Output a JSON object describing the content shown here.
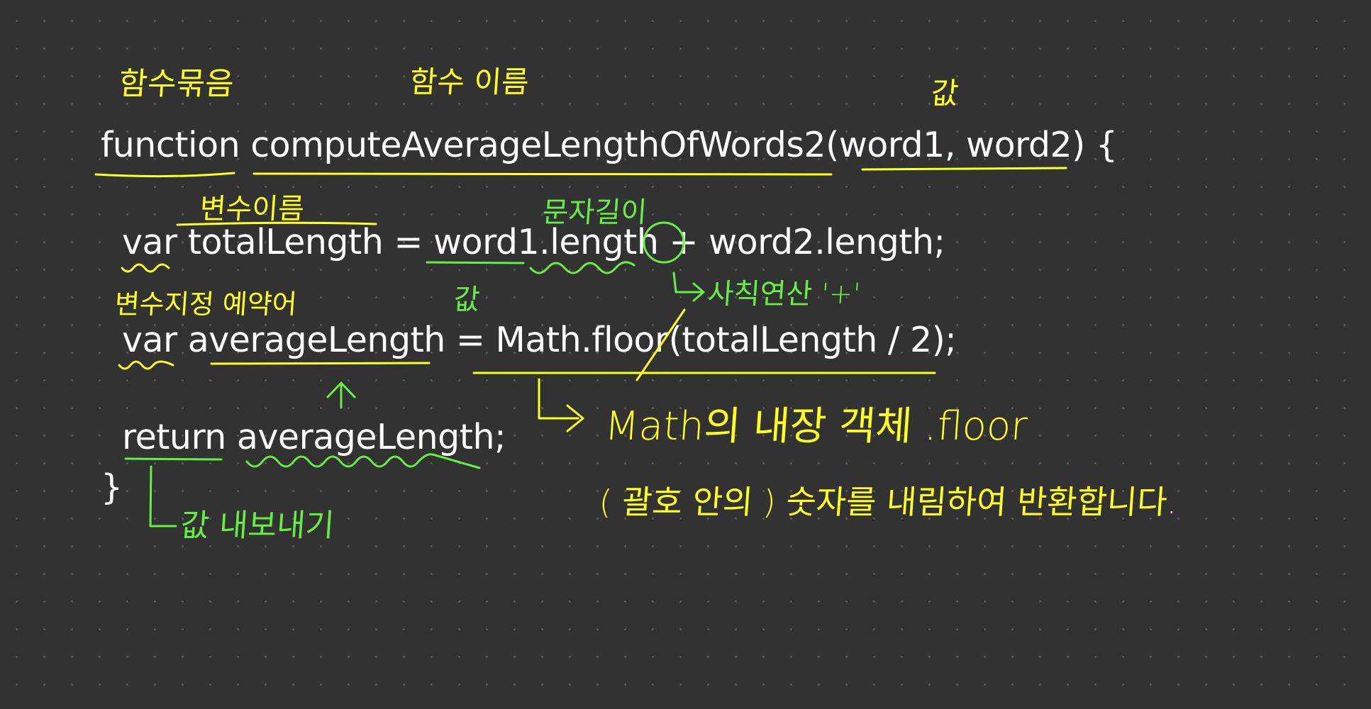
{
  "code_lines": {
    "line1": "function computeAverageLengthOfWords2(word1, word2) {",
    "line2": "var totalLength = word1.length + word2.length;",
    "line3": "var averageLength = Math.floor(totalLength / 2);",
    "line4": "return averageLength;",
    "line5": "}"
  },
  "annotations": {
    "function_bundle": "함수묶음",
    "function_name": "함수 이름",
    "value_param": "값",
    "variable_name": "변수이름",
    "string_length": "문자길이",
    "variable_keyword": "변수지정 예약어",
    "value_word1": "값",
    "arithmetic_plus": "사칙연산 '+'",
    "math_builtin": "Math의 내장 객체   .floor",
    "floor_explain": "( 괄호 안의 ) 숫자를 내림하여 반환합니다.",
    "return_value": "값 내보내기"
  },
  "colors": {
    "background": "#323232",
    "code_text": "#ffffff",
    "yellow_ink": "#ffff22",
    "green_ink": "#66ee44"
  }
}
